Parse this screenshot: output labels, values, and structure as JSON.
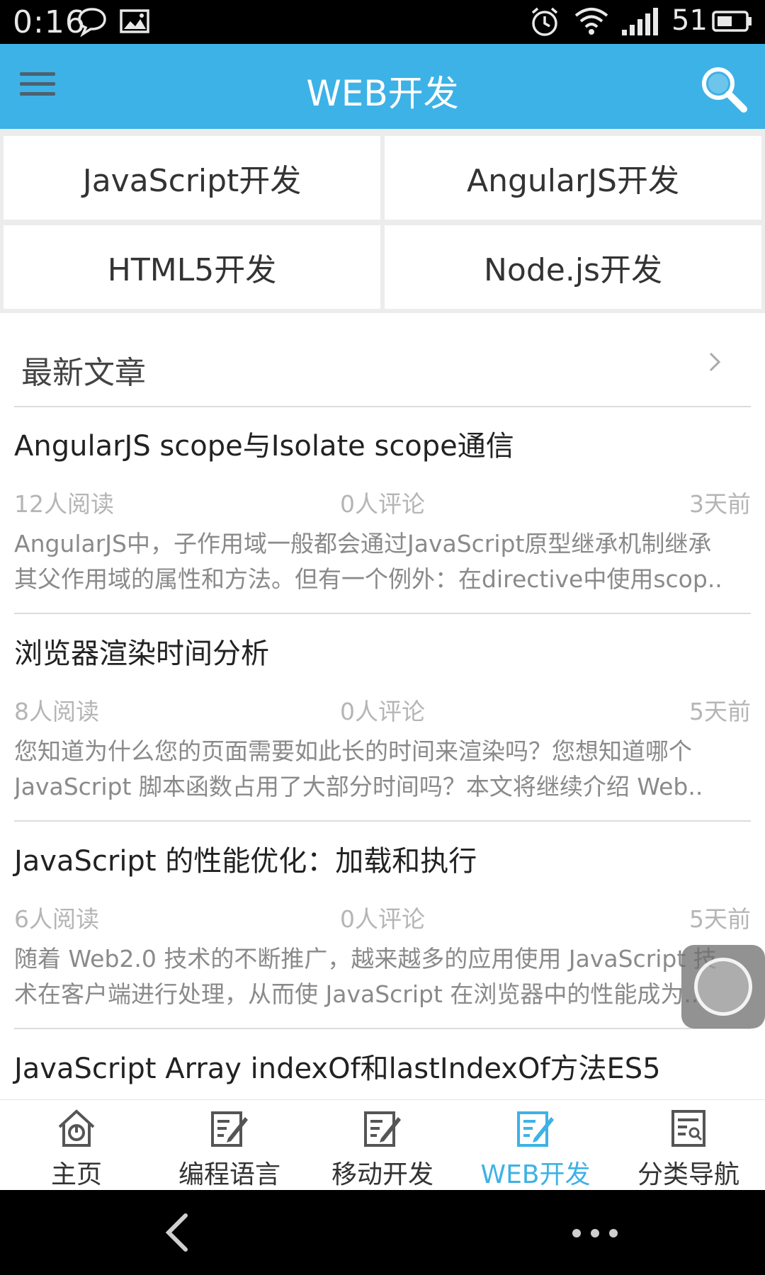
{
  "status_bar": {
    "time": "0:16",
    "battery_level": "51",
    "icons": [
      "chat-bubble-icon",
      "image-icon",
      "alarm-icon",
      "wifi-icon",
      "signal-icon",
      "battery-icon"
    ]
  },
  "app_bar": {
    "title": "WEB开发",
    "menu_icon": "hamburger-menu-icon",
    "search_icon": "search-icon",
    "color": "#3db2e6"
  },
  "categories": [
    {
      "label": "JavaScript开发"
    },
    {
      "label": "AngularJS开发"
    },
    {
      "label": "HTML5开发"
    },
    {
      "label": "Node.js开发"
    }
  ],
  "latest": {
    "heading": "最新文章",
    "articles": [
      {
        "title": "AngularJS scope与Isolate scope通信",
        "reads": "12人阅读",
        "comments": "0人评论",
        "age": "3天前",
        "summary_line1": "AngularJS中，子作用域一般都会通过JavaScript原型继承机制继承",
        "summary_line2": "其父作用域的属性和方法。但有一个例外：在directive中使用scop.."
      },
      {
        "title": "浏览器渲染时间分析",
        "reads": "8人阅读",
        "comments": "0人评论",
        "age": "5天前",
        "summary_line1": "您知道为什么您的页面需要如此长的时间来渲染吗？您想知道哪个",
        "summary_line2": "JavaScript 脚本函数占用了大部分时间吗？本文将继续介绍 Web.."
      },
      {
        "title": "JavaScript 的性能优化：加载和执行",
        "reads": "6人阅读",
        "comments": "0人评论",
        "age": "5天前",
        "summary_line1": "随着 Web2.0 技术的不断推广，越来越多的应用使用 JavaScript 技",
        "summary_line2": "术在客户端进行处理，从而使 JavaScript 在浏览器中的性能成为.."
      },
      {
        "title": "JavaScript Array indexOf和lastIndexOf方法ES5"
      }
    ]
  },
  "bottom_nav": {
    "items": [
      {
        "label": "主页",
        "icon": "home-icon"
      },
      {
        "label": "编程语言",
        "icon": "edit-note-icon"
      },
      {
        "label": "移动开发",
        "icon": "edit-note-icon"
      },
      {
        "label": "WEB开发",
        "icon": "edit-note-icon",
        "active": true
      },
      {
        "label": "分类导航",
        "icon": "category-list-icon"
      }
    ],
    "active_color": "#3db2e6"
  }
}
